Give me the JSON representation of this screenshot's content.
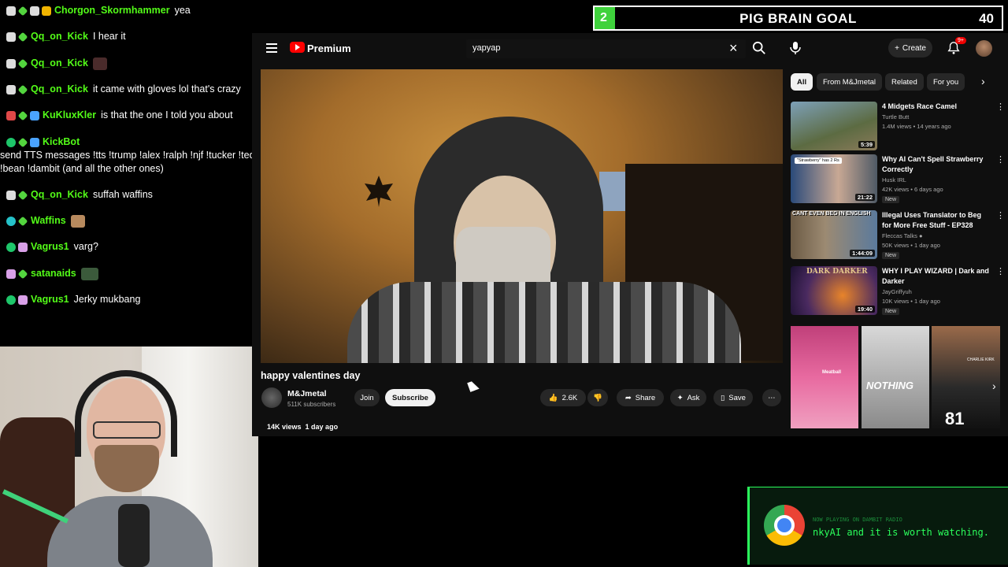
{
  "chat": {
    "messages": [
      {
        "user": "Chorgon_Skormhammer",
        "text": "yea"
      },
      {
        "user": "Qq_on_Kick",
        "text": "I hear it"
      },
      {
        "user": "Qq_on_Kick",
        "text": ""
      },
      {
        "user": "Qq_on_Kick",
        "text": "it came with gloves lol that's crazy"
      },
      {
        "user": "KuKluxKler",
        "text": "is that the one I told you about"
      },
      {
        "user": "KickBot",
        "text": "send TTS messages !tts !trump !alex !ralph !njf !tucker !teddy !bean !dambit (and all the other ones)"
      },
      {
        "user": "Qq_on_Kick",
        "text": "suffah waffins"
      },
      {
        "user": "Waffins",
        "text": ""
      },
      {
        "user": "Vagrus1",
        "text": "varg?"
      },
      {
        "user": "satanaids",
        "text": ""
      },
      {
        "user": "Vagrus1",
        "text": "Jerky mukbang"
      }
    ]
  },
  "goal": {
    "current": "2",
    "title": "PIG BRAIN GOAL",
    "target": "40",
    "progress_fraction": 0.05,
    "fill_color": "#3fd23c"
  },
  "youtube": {
    "brand": "Premium",
    "search": {
      "value": "yapyap"
    },
    "create_label": "Create",
    "notification_count": "9+",
    "video": {
      "title": "happy valentines day",
      "channel": "M&Jmetal",
      "subscribers": "511K subscribers",
      "join_label": "Join",
      "subscribe_label": "Subscribe",
      "likes": "2.6K",
      "share_label": "Share",
      "ask_label": "Ask",
      "save_label": "Save",
      "views": "14K views",
      "age": "1 day ago"
    },
    "chips": [
      "All",
      "From M&Jmetal",
      "Related",
      "For you"
    ],
    "recommendations": [
      {
        "title": "4 Midgets Race Camel",
        "channel": "Turtle Butt",
        "meta": "1.4M views • 14 years ago",
        "duration": "5:39",
        "new": ""
      },
      {
        "title": "Why AI Can't Spell Strawberry Correctly",
        "channel": "Husk IRL",
        "meta": "42K views • 6 days ago",
        "duration": "21:22",
        "new": "New"
      },
      {
        "title": "Illegal Uses Translator to Beg for More Free Stuff - EP328",
        "channel": "Fleccas Talks",
        "meta": "50K views • 1 day ago",
        "duration": "1:44:09",
        "new": "New"
      },
      {
        "title": "WHY I PLAY WIZARD | Dark and Darker",
        "channel": "JayGriffyuh",
        "meta": "10K views • 1 day ago",
        "duration": "19:40",
        "new": "New"
      }
    ],
    "thumb_texts": {
      "strawberry_caption": "\"Strawberry\" has 2 Rs",
      "beg_caption": "CANT EVEN BEG IN ENGLISH",
      "dark_caption": "DARK DARKER"
    },
    "shorts": [
      {
        "label": "Meatball"
      },
      {
        "label": "NOTHING"
      },
      {
        "label": "CHARLIE KIRK",
        "number": "81"
      }
    ]
  },
  "toast": {
    "small_text": "NOW PLAYING ON DAMBIT RADIO",
    "big_text": "nkyAI and it is worth watching."
  }
}
